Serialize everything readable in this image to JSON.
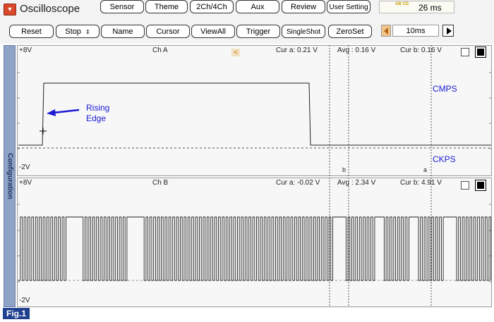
{
  "app": {
    "title": "Oscilloscope",
    "icon": "dropdown-icon"
  },
  "toolbar_top": [
    "Sensor",
    "Theme",
    "2Ch/4Ch",
    "Aux",
    "Review",
    "User Setting"
  ],
  "time_readout": {
    "badge": "AB\nCD",
    "value": "26 ms"
  },
  "toolbar_bottom": [
    {
      "label": "Reset"
    },
    {
      "label": "Stop",
      "spinner": true
    },
    {
      "label": "Name"
    },
    {
      "label": "Cursor"
    },
    {
      "label": "ViewAll"
    },
    {
      "label": "Trigger"
    },
    {
      "label": "SingleShot"
    },
    {
      "label": "ZeroSet"
    }
  ],
  "time_base": {
    "value": "10ms"
  },
  "sidebar": {
    "label": "Configuration"
  },
  "panel_a": {
    "name": "Ch A",
    "max": "+8V",
    "min": "-2V",
    "cur_a": "Cur a: 0.21 V",
    "avg": "Avg : 0.16 V",
    "cur_b": "Cur b: 0.16 V",
    "signal_1": "CMPS",
    "signal_2": "CKPS",
    "annotation": "Rising\nEdge",
    "marker_b": "b",
    "marker_a": "a"
  },
  "panel_b": {
    "name": "Ch B",
    "max": "+8V",
    "min": "-2V",
    "cur_a": "Cur a: -0.02 V",
    "avg": "Avg : 2.34 V",
    "cur_b": "Cur b: 4.91 V"
  },
  "figure_label": "Fig.1",
  "colors": {
    "accent": "#1f3f8f",
    "annotation": "#1a1ad6",
    "sidebar": "#8fa3c7"
  }
}
